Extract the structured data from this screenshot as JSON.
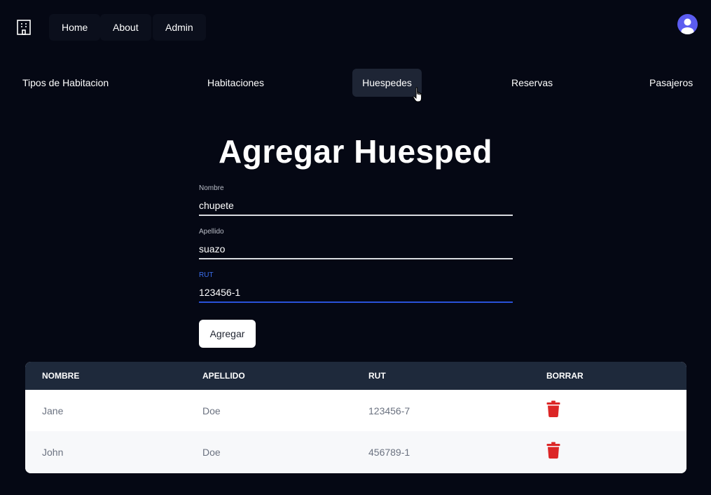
{
  "topbar": {
    "logo_icon": "building-icon",
    "links": [
      {
        "label": "Home"
      },
      {
        "label": "About"
      },
      {
        "label": "Admin"
      }
    ],
    "avatar_icon": "user-avatar-icon"
  },
  "subnav": {
    "items": [
      {
        "label": "Tipos de Habitacion"
      },
      {
        "label": "Habitaciones"
      },
      {
        "label": "Huespedes"
      },
      {
        "label": "Reservas"
      },
      {
        "label": "Pasajeros"
      }
    ],
    "active": "Huespedes"
  },
  "form": {
    "title": "Agregar Huesped",
    "fields": {
      "nombre": {
        "label": "Nombre",
        "value": "chupete"
      },
      "apellido": {
        "label": "Apellido",
        "value": "suazo"
      },
      "rut": {
        "label": "RUT",
        "value": "123456-1"
      }
    },
    "submit_label": "Agregar"
  },
  "table": {
    "headers": [
      "NOMBRE",
      "APELLIDO",
      "RUT",
      "BORRAR"
    ],
    "rows": [
      {
        "nombre": "Jane",
        "apellido": "Doe",
        "rut": "123456-7"
      },
      {
        "nombre": "John",
        "apellido": "Doe",
        "rut": "456789-1"
      }
    ],
    "delete_icon": "trash-icon"
  },
  "colors": {
    "background": "#050814",
    "active_tab": "#1e2535",
    "table_header": "#1e293b",
    "focus_accent": "#2952d9",
    "delete": "#dc2626",
    "avatar": "#5b5cf0"
  }
}
